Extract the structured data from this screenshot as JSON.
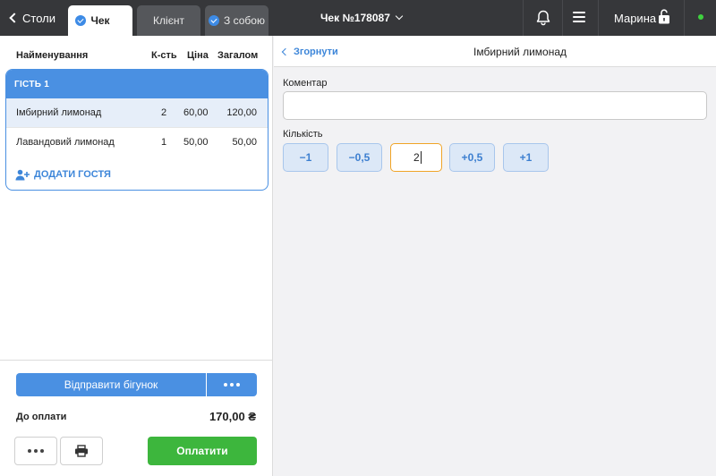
{
  "topbar": {
    "back_label": "Столи",
    "tabs": [
      {
        "label": "Чек",
        "active": true,
        "checked": true
      },
      {
        "label": "Клієнт",
        "active": false,
        "checked": false
      },
      {
        "label": "З собою",
        "active": false,
        "checked": true
      }
    ],
    "order_title": "Чек №178087",
    "user_name": "Марина",
    "icons": [
      "chevron-left-icon",
      "check-icon",
      "chevron-down-icon",
      "bell-icon",
      "hamburger-menu-icon",
      "unlock-icon",
      "online-status-icon"
    ],
    "status_color": "#3fd13f"
  },
  "order": {
    "columns": {
      "name": "Найменування",
      "qty": "К-сть",
      "price": "Ціна",
      "total": "Загалом"
    },
    "guest_label": "ГІСТЬ 1",
    "items": [
      {
        "name": "Імбирний лимонад",
        "qty": "2",
        "price": "60,00",
        "total": "120,00",
        "selected": true
      },
      {
        "name": "Лавандовий лимонад",
        "qty": "1",
        "price": "50,00",
        "total": "50,00",
        "selected": false
      }
    ],
    "add_guest_label": "ДОДАТИ ГОСТЯ",
    "send_label": "Відправити бігунок",
    "total_label": "До оплати",
    "total_value": "170,00 ₴",
    "pay_label": "Оплатити",
    "accent_color": "#4a90e2",
    "pay_color": "#3db63d"
  },
  "detail": {
    "collapse_label": "Згорнути",
    "item_title": "Імбирний лимонад",
    "comment_label": "Коментар",
    "comment_value": "",
    "quantity_label": "Кількість",
    "quantity_buttons": [
      "−1",
      "−0,5",
      "+0,5",
      "+1"
    ],
    "quantity_value": "2",
    "focus_color": "#f0a426"
  }
}
